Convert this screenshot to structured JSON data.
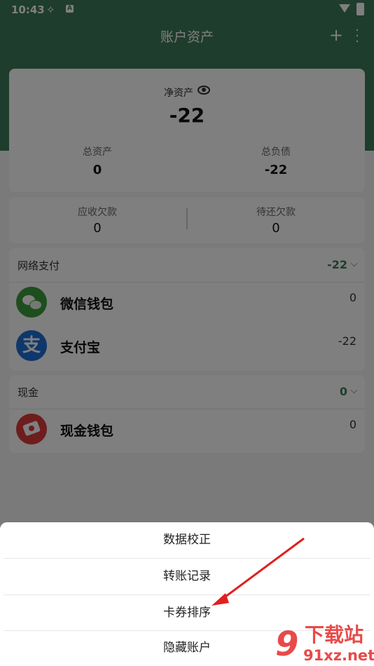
{
  "status_bar": {
    "time": "10:43",
    "notif_letter": "A"
  },
  "app_bar": {
    "title": "账户资产",
    "add_label": "+",
    "more_label": "⋮"
  },
  "summary": {
    "net_label": "净资产",
    "net_value": "-22",
    "total_assets_label": "总资产",
    "total_assets_value": "0",
    "total_liabilities_label": "总负债",
    "total_liabilities_value": "-22"
  },
  "debts": {
    "receivable_label": "应收欠款",
    "receivable_value": "0",
    "payable_label": "待还欠款",
    "payable_value": "0"
  },
  "groups": [
    {
      "name": "网络支付",
      "total": "-22",
      "accounts": [
        {
          "name": "微信钱包",
          "amount": "0",
          "icon": "wechat-icon"
        },
        {
          "name": "支付宝",
          "amount": "-22",
          "icon": "alipay-icon"
        }
      ]
    },
    {
      "name": "现金",
      "total": "0",
      "accounts": [
        {
          "name": "现金钱包",
          "amount": "0",
          "icon": "cash-icon"
        }
      ]
    }
  ],
  "alipay_glyph": "支",
  "bottom_sheet": {
    "items": [
      "数据校正",
      "转账记录",
      "卡券排序",
      "隐藏账户"
    ]
  },
  "watermark": {
    "logo": "9",
    "title": "下载站",
    "url": "91xz.net"
  },
  "colors": {
    "primary": "#3f7a58",
    "wechat": "#3f9c3c",
    "alipay": "#1f6fd6",
    "cash": "#dc3b3b",
    "arrow": "#e02020"
  }
}
